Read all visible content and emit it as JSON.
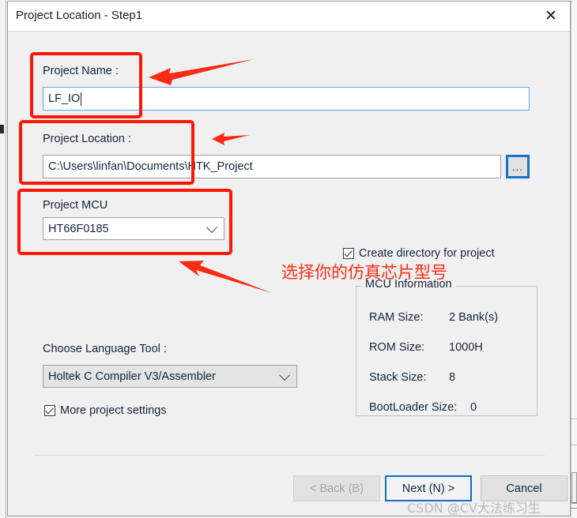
{
  "window": {
    "title": "Project Location - Step1",
    "close_icon": "close-icon"
  },
  "form": {
    "project_name": {
      "label": "Project Name :",
      "value": "LF_IO",
      "placeholder": ""
    },
    "project_location": {
      "label": "Project Location :",
      "value": "C:\\Users\\linfan\\Documents\\HTK_Project",
      "placeholder": "",
      "browse_label": "..."
    },
    "project_mcu": {
      "label": "Project MCU",
      "value": "HT66F0185"
    },
    "language_tool": {
      "label": "Choose Language Tool :",
      "value": "Holtek C Compiler V3/Assembler"
    },
    "create_directory": {
      "label": "Create directory for project",
      "checked": true
    },
    "more_settings": {
      "label": "More project settings",
      "checked": true
    }
  },
  "mcu_information": {
    "title": "MCU Information",
    "rows": [
      {
        "key": "RAM Size:",
        "value": "2 Bank(s)"
      },
      {
        "key": "ROM Size:",
        "value": "1000H"
      },
      {
        "key": "Stack Size:",
        "value": "8"
      },
      {
        "key": "BootLoader Size:",
        "value": "0"
      }
    ]
  },
  "footer": {
    "back_label": "< Back (B)",
    "back_mnemonic": "B",
    "next_label": "Next (N) >",
    "next_mnemonic": "N",
    "cancel_label": "Cancel"
  },
  "annotations": {
    "note_text": "选择你的仿真芯片型号",
    "highlight_color": "#fc1705",
    "arrow_color": "#fb2c13"
  },
  "watermark": "CSDN @CV大法练习生"
}
